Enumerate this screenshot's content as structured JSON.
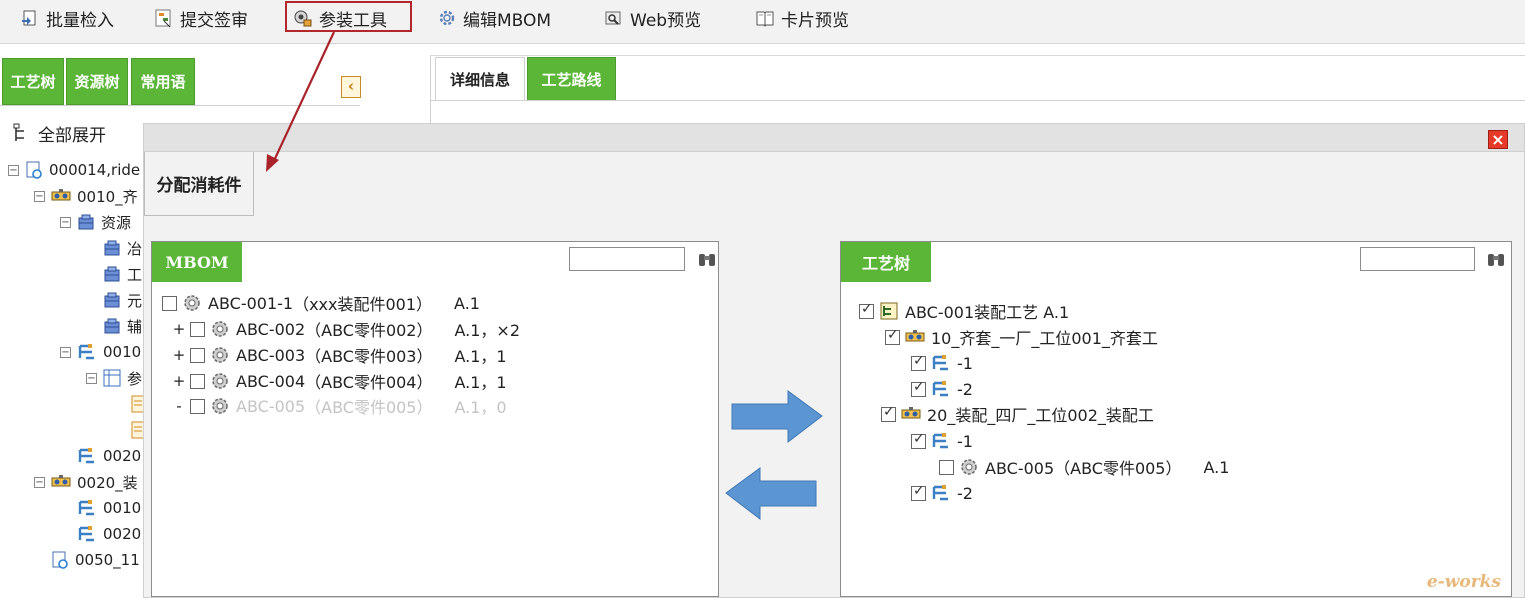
{
  "toolbar": {
    "items": [
      {
        "label": "批量检入",
        "icon": "checkin-icon"
      },
      {
        "label": "提交签审",
        "icon": "submit-icon"
      },
      {
        "label": "参装工具",
        "icon": "assembly-tool-icon"
      },
      {
        "label": "编辑MBOM",
        "icon": "gear-icon"
      },
      {
        "label": "Web预览",
        "icon": "web-preview-icon"
      },
      {
        "label": "卡片预览",
        "icon": "book-icon"
      }
    ]
  },
  "left_panel": {
    "tabs": [
      "工艺树",
      "资源树",
      "常用语"
    ],
    "expand_all": "全部展开",
    "tree": [
      {
        "label": "000014,ride",
        "level": 0,
        "toggle": "⊟",
        "icon": "doc-refresh-icon"
      },
      {
        "label": "0010_齐",
        "level": 1,
        "toggle": "⊟",
        "icon": "station-icon"
      },
      {
        "label": "资源",
        "level": 2,
        "toggle": "⊟",
        "icon": "resource-icon"
      },
      {
        "label": "冶",
        "level": 3,
        "toggle": "",
        "icon": "resource-icon"
      },
      {
        "label": "工",
        "level": 3,
        "toggle": "",
        "icon": "resource-icon"
      },
      {
        "label": "元",
        "level": 3,
        "toggle": "",
        "icon": "resource-icon"
      },
      {
        "label": "辅",
        "level": 3,
        "toggle": "",
        "icon": "resource-icon"
      },
      {
        "label": "0010",
        "level": 2,
        "toggle": "⊟",
        "icon": "step-icon"
      },
      {
        "label": "参",
        "level": 3,
        "toggle": "⊟",
        "icon": "table-icon"
      },
      {
        "label": "",
        "level": 4,
        "toggle": "",
        "icon": "doc-icon"
      },
      {
        "label": "",
        "level": 4,
        "toggle": "",
        "icon": "doc-icon"
      },
      {
        "label": "0020",
        "level": 2,
        "toggle": "",
        "icon": "step-icon"
      },
      {
        "label": "0020_装",
        "level": 1,
        "toggle": "⊟",
        "icon": "station-icon"
      },
      {
        "label": "0010",
        "level": 2,
        "toggle": "",
        "icon": "step-icon"
      },
      {
        "label": "0020",
        "level": 2,
        "toggle": "",
        "icon": "step-icon"
      },
      {
        "label": "0050_11",
        "level": 1,
        "toggle": "",
        "icon": "doc-refresh-icon"
      }
    ]
  },
  "right_tabs": [
    "详细信息",
    "工艺路线"
  ],
  "dialog": {
    "tab_label": "分配消耗件",
    "close_label": "×",
    "mbom": {
      "title": "MBOM",
      "search_placeholder": "",
      "rows": [
        {
          "toggle": "",
          "checked": false,
          "code": "ABC-001-1",
          "name": "（xxx装配件001）",
          "rev": "A.1",
          "dim": false
        },
        {
          "toggle": "+",
          "checked": false,
          "code": "ABC-002",
          "name": "（ABC零件002）",
          "rev": "A.1，×2",
          "dim": false
        },
        {
          "toggle": "+",
          "checked": false,
          "code": "ABC-003",
          "name": "（ABC零件003）",
          "rev": "A.1，1",
          "dim": false
        },
        {
          "toggle": "+",
          "checked": false,
          "code": "ABC-004",
          "name": "（ABC零件004）",
          "rev": "A.1，1",
          "dim": false
        },
        {
          "toggle": "-",
          "checked": false,
          "code": "ABC-005",
          "name": "（ABC零件005）",
          "rev": "A.1，0",
          "dim": true
        }
      ]
    },
    "process_tree": {
      "title": "工艺树",
      "search_placeholder": "",
      "rows": [
        {
          "checked": true,
          "icon": "process-icon",
          "label": "ABC-001装配工艺 A.1"
        },
        {
          "checked": true,
          "icon": "station-icon",
          "label": "10_齐套_一厂_工位001_齐套工"
        },
        {
          "checked": true,
          "icon": "step-icon",
          "label": "-1"
        },
        {
          "checked": true,
          "icon": "step-icon",
          "label": "-2"
        },
        {
          "checked": true,
          "icon": "station-icon",
          "label": "20_装配_四厂_工位002_装配工"
        },
        {
          "checked": true,
          "icon": "step-icon",
          "label": "-1"
        },
        {
          "checked": false,
          "icon": "gear-icon",
          "label": "ABC-005（ABC零件005）",
          "rev": "A.1"
        },
        {
          "checked": true,
          "icon": "step-icon",
          "label": "-2"
        }
      ]
    },
    "arrows": {
      "right": "assign-right-arrow",
      "left": "assign-left-arrow"
    }
  },
  "colors": {
    "green": "#5bb638",
    "arrow_blue": "#5b95d2",
    "highlight_red": "#b3262c",
    "close_red": "#e53a2a"
  }
}
